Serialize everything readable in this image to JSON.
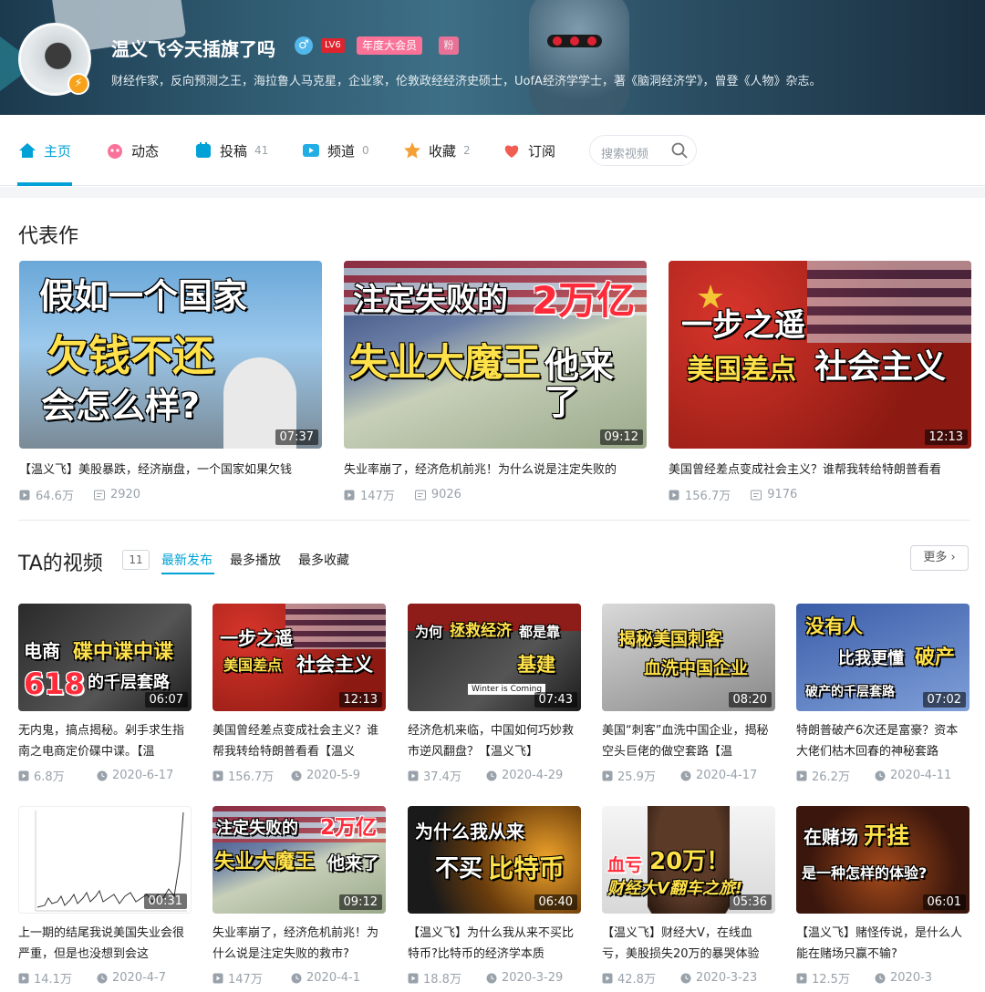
{
  "profile": {
    "name": "温义飞今天插旗了吗",
    "level": "LV6",
    "vip": "年度大会员",
    "fan_badge": "粉",
    "sign": "财经作家，反向预测之王，海拉鲁人马克星，企业家，伦敦政经经济史硕士，UofA经济学学士，著《脑洞经济学》，曾登《人物》杂志。"
  },
  "nav": {
    "items": [
      {
        "label": "主页",
        "count": ""
      },
      {
        "label": "动态",
        "count": ""
      },
      {
        "label": "投稿",
        "count": "41"
      },
      {
        "label": "频道",
        "count": "0"
      },
      {
        "label": "收藏",
        "count": "2"
      },
      {
        "label": "订阅",
        "count": ""
      }
    ],
    "search_placeholder": "搜索视频"
  },
  "representative": {
    "title": "代表作",
    "items": [
      {
        "thumb_lines": [
          "假如一个国家",
          "欠钱不还",
          "会怎么样?"
        ],
        "duration": "07:37",
        "title": "【温义飞】美股暴跌，经济崩盘，一个国家如果欠钱",
        "views": "64.6万",
        "danmaku": "2920"
      },
      {
        "thumb_lines": [
          "注定失败的",
          "2万亿",
          "失业大魔王",
          "他来了"
        ],
        "duration": "09:12",
        "title": "失业率崩了，经济危机前兆！为什么说是注定失败的",
        "views": "147万",
        "danmaku": "9026"
      },
      {
        "thumb_lines": [
          "一步之遥",
          "美国差点",
          "社会主义"
        ],
        "duration": "12:13",
        "title": "美国曾经差点变成社会主义？谁帮我转给特朗普看看",
        "views": "156.7万",
        "danmaku": "9176"
      }
    ]
  },
  "ta_videos": {
    "title": "TA的视频",
    "count": "11",
    "tabs": [
      "最新发布",
      "最多播放",
      "最多收藏"
    ],
    "more": "更多",
    "items": [
      {
        "thumb_lines": [
          "电商",
          "碟中谍中谍",
          "618",
          "的千层套路"
        ],
        "duration": "06:07",
        "title": "无内鬼，搞点揭秘。剁手求生指南之电商定价碟中谍。【温",
        "views": "6.8万",
        "date": "2020-6-17"
      },
      {
        "thumb_lines": [
          "一步之遥",
          "美国差点",
          "社会主义"
        ],
        "duration": "12:13",
        "title": "美国曾经差点变成社会主义？谁帮我转给特朗普看看【温义",
        "views": "156.7万",
        "date": "2020-5-9"
      },
      {
        "thumb_lines": [
          "为何",
          "拯救经济",
          "都是靠",
          "基建",
          "Winter is Coming"
        ],
        "duration": "07:43",
        "title": "经济危机来临，中国如何巧妙救市逆风翻盘？【温义飞】",
        "views": "37.4万",
        "date": "2020-4-29"
      },
      {
        "thumb_lines": [
          "揭秘美国刺客",
          "血洗中国企业"
        ],
        "duration": "08:20",
        "title": "美国“刺客”血洗中国企业，揭秘空头巨佬的做空套路【温",
        "views": "25.9万",
        "date": "2020-4-17"
      },
      {
        "thumb_lines": [
          "没有人",
          "比我更懂",
          "破产",
          "破产的千层套路"
        ],
        "duration": "07:02",
        "title": "特朗普破产6次还是富豪？资本大佬们枯木回春的神秘套路",
        "views": "26.2万",
        "date": "2020-4-11"
      },
      {
        "thumb_lines": [],
        "duration": "00:31",
        "title": "上一期的结尾我说美国失业会很严重，但是也没想到会这",
        "views": "14.1万",
        "date": "2020-4-7"
      },
      {
        "thumb_lines": [
          "注定失败的",
          "2万亿",
          "失业大魔王",
          "他来了"
        ],
        "duration": "09:12",
        "title": "失业率崩了，经济危机前兆！为什么说是注定失败的救市?",
        "views": "147万",
        "date": "2020-4-1"
      },
      {
        "thumb_lines": [
          "为什么我从来",
          "不买",
          "比特币"
        ],
        "duration": "06:40",
        "title": "【温义飞】为什么我从来不买比特币?比特币的经济学本质",
        "views": "18.8万",
        "date": "2020-3-29"
      },
      {
        "thumb_lines": [
          "血亏",
          "20万！",
          "财经大V翻车之旅!"
        ],
        "duration": "05:36",
        "title": "【温义飞】财经大V，在线血亏，美股损失20万的暴哭体验",
        "views": "42.8万",
        "date": "2020-3-23"
      },
      {
        "thumb_lines": [
          "在赌场",
          "开挂",
          "是一种怎样的体验?"
        ],
        "duration": "06:01",
        "title": "【温义飞】赌怪传说，是什么人能在赌场只赢不输?",
        "views": "12.5万",
        "date": "2020-3"
      }
    ]
  }
}
